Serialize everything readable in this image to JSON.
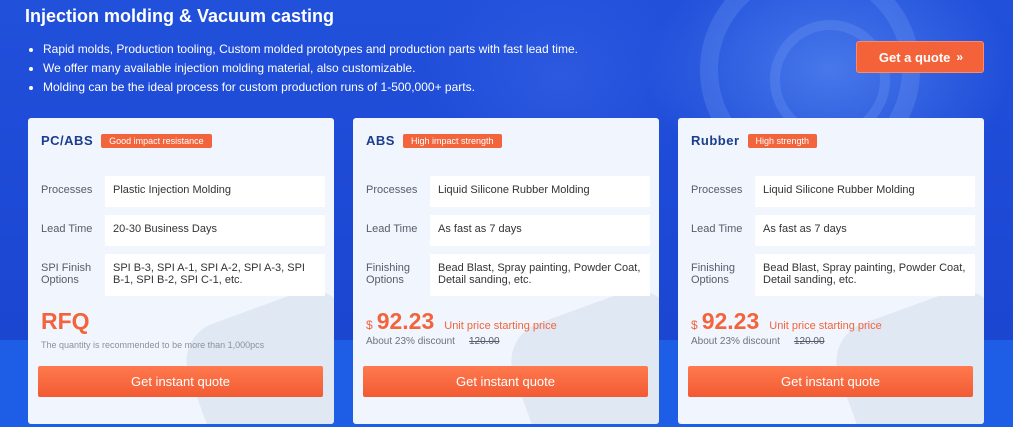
{
  "header": {
    "title": "Injection molding & Vacuum casting",
    "bullets": [
      "Rapid molds, Production tooling, Custom molded prototypes and production parts with fast lead time.",
      "We offer many available injection molding material, also customizable.",
      "Molding can be the ideal process for custom production runs of 1-500,000+ parts."
    ],
    "quote_button": {
      "label": "Get a quote",
      "icon": "double-chevron-right-icon",
      "glyph": "»"
    }
  },
  "colors": {
    "accent": "#f2643c",
    "background": "#1f52e0",
    "card": "#f1f5fd",
    "card_title": "#1a3d8f"
  },
  "cards": [
    {
      "title": "PC/ABS",
      "tag": "Good impact resistance",
      "rows": [
        {
          "label": "Processes",
          "value": "Plastic Injection Molding"
        },
        {
          "label": "Lead Time",
          "value": "20-30 Business Days"
        },
        {
          "label": "SPI Finish Options",
          "value": "SPI B-3, SPI A-1, SPI A-2, SPI A-3, SPI B-1, SPI B-2, SPI C-1, etc."
        }
      ],
      "rfq": "RFQ",
      "note": "The quantity is recommended to be more than 1,000pcs",
      "button": "Get instant quote"
    },
    {
      "title": "ABS",
      "tag": "High impact strength",
      "rows": [
        {
          "label": "Processes",
          "value": "Liquid Silicone Rubber Molding"
        },
        {
          "label": "Lead Time",
          "value": "As fast as 7 days"
        },
        {
          "label": "Finishing Options",
          "value": "Bead Blast, Spray painting, Powder Coat, Detail sanding, etc."
        }
      ],
      "currency": "$",
      "price": "92.23",
      "unit_label": "Unit price starting price",
      "discount": "About 23% discount",
      "old_price": "120.00",
      "button": "Get instant quote"
    },
    {
      "title": "Rubber",
      "tag": "High strength",
      "rows": [
        {
          "label": "Processes",
          "value": "Liquid Silicone Rubber Molding"
        },
        {
          "label": "Lead Time",
          "value": "As fast as 7 days"
        },
        {
          "label": "Finishing Options",
          "value": "Bead Blast, Spray painting, Powder Coat, Detail sanding, etc."
        }
      ],
      "currency": "$",
      "price": "92.23",
      "unit_label": "Unit price starting price",
      "discount": "About 23% discount",
      "old_price": "120.00",
      "button": "Get instant quote"
    }
  ]
}
